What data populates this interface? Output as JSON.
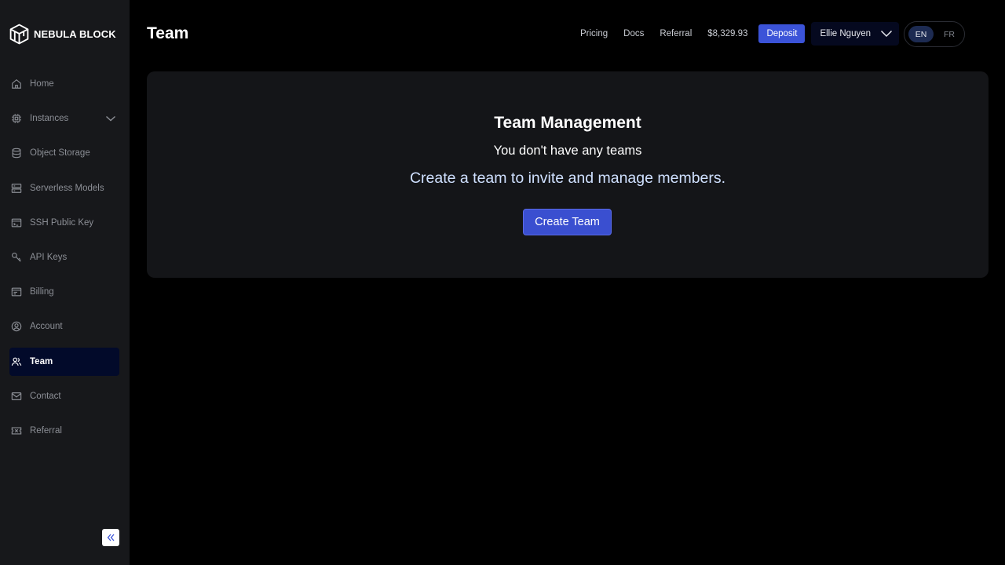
{
  "brand": {
    "name": "NEBULA BLOCK",
    "logo_icon": "cube-logo-icon"
  },
  "sidebar": {
    "items": [
      {
        "label": "Home",
        "icon": "home-icon",
        "active": false
      },
      {
        "label": "Instances",
        "icon": "chip-icon",
        "active": false,
        "expandable": true
      },
      {
        "label": "Object Storage",
        "icon": "database-icon",
        "active": false
      },
      {
        "label": "Serverless Models",
        "icon": "server-icon",
        "active": false
      },
      {
        "label": "SSH Public Key",
        "icon": "terminal-icon",
        "active": false
      },
      {
        "label": "API Keys",
        "icon": "key-icon",
        "active": false
      },
      {
        "label": "Billing",
        "icon": "billing-icon",
        "active": false
      },
      {
        "label": "Account",
        "icon": "user-circle-icon",
        "active": false
      },
      {
        "label": "Team",
        "icon": "team-icon",
        "active": true
      },
      {
        "label": "Contact",
        "icon": "mail-icon",
        "active": false
      },
      {
        "label": "Referral",
        "icon": "ticket-icon",
        "active": false
      }
    ],
    "collapse_icon": "double-chevron-left-icon"
  },
  "header": {
    "title": "Team",
    "links": [
      "Pricing",
      "Docs",
      "Referral"
    ],
    "balance": "$8,329.93",
    "deposit_label": "Deposit",
    "user_name": "Ellie Nguyen",
    "languages": {
      "active": "EN",
      "inactive": "FR"
    }
  },
  "main": {
    "card_title": "Team Management",
    "empty_message": "You don't have any teams",
    "description": "Create a team to invite and manage members.",
    "create_button_label": "Create Team"
  },
  "colors": {
    "accent": "#3b53d8",
    "sidebar_bg": "#17181b",
    "card_bg": "#141518",
    "active_item_bg": "#020a2a"
  }
}
